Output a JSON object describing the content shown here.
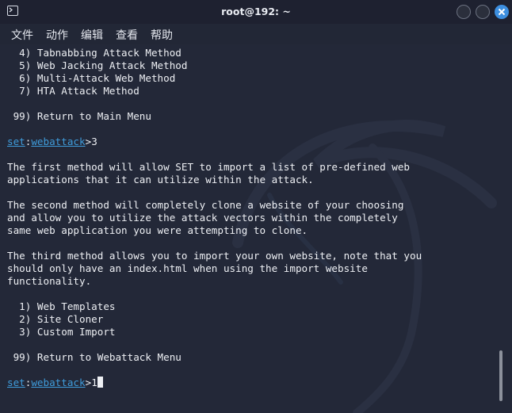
{
  "window": {
    "title": "root@192: ~"
  },
  "menubar": {
    "items": [
      "文件",
      "动作",
      "编辑",
      "查看",
      "帮助"
    ]
  },
  "terminal": {
    "prompt_set": "set",
    "prompt_sep": ":",
    "prompt_module": "webattack",
    "prompt_gt": ">",
    "lines": [
      "  4) Tabnabbing Attack Method",
      "  5) Web Jacking Attack Method",
      "  6) Multi-Attack Web Method",
      "  7) HTA Attack Method",
      "",
      " 99) Return to Main Menu",
      "",
      "__PROMPT1__",
      "",
      "The first method will allow SET to import a list of pre-defined web",
      "applications that it can utilize within the attack.",
      "",
      "The second method will completely clone a website of your choosing",
      "and allow you to utilize the attack vectors within the completely",
      "same web application you were attempting to clone.",
      "",
      "The third method allows you to import your own website, note that you",
      "should only have an index.html when using the import website",
      "functionality.",
      "",
      "  1) Web Templates",
      "  2) Site Cloner",
      "  3) Custom Import",
      "",
      " 99) Return to Webattack Menu",
      "",
      "__PROMPT2__"
    ],
    "prompt1_input": "3",
    "prompt2_input": "1"
  },
  "colors": {
    "background": "#232838",
    "text": "#eef0f4",
    "prompt": "#3f9cdb",
    "close_button": "#3d8fe0"
  },
  "icons": {
    "app": "terminal-icon",
    "minimize": "minimize-icon",
    "maximize": "maximize-icon",
    "close": "close-icon"
  }
}
